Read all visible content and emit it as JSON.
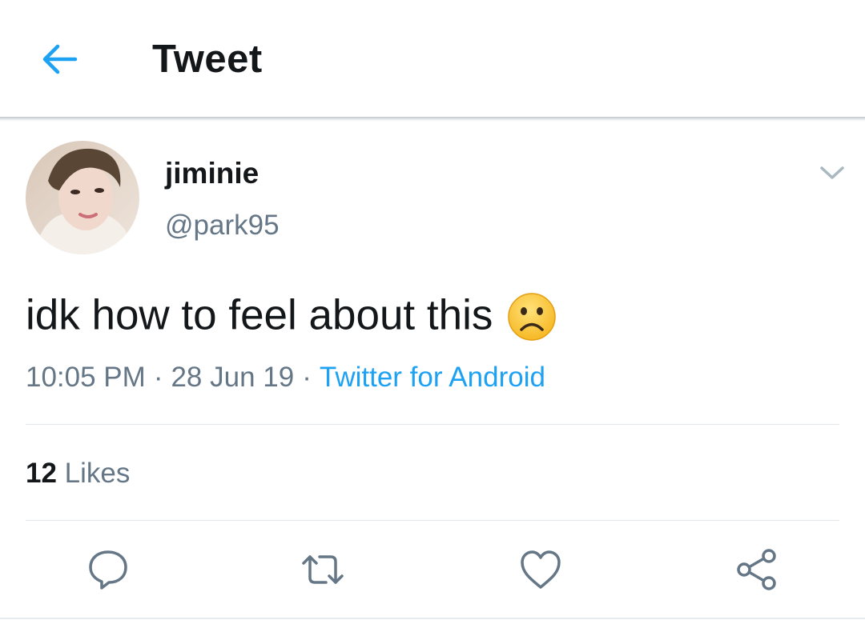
{
  "header": {
    "title": "Tweet",
    "back_icon": "arrow-left-icon"
  },
  "tweet": {
    "display_name": "jiminie",
    "handle": "@park95",
    "text": "idk how to feel about this",
    "emoji_icon": "frowning-face-icon",
    "time": "10:05 PM",
    "date": "28 Jun 19",
    "separator": "·",
    "source": "Twitter for Android",
    "likes_count": "12",
    "likes_label": "Likes"
  },
  "actions": [
    "reply-icon",
    "retweet-icon",
    "like-icon",
    "share-icon"
  ],
  "colors": {
    "accent": "#1da1f2",
    "text": "#14171a",
    "secondary": "#657786",
    "divider": "#e1e8ed"
  }
}
